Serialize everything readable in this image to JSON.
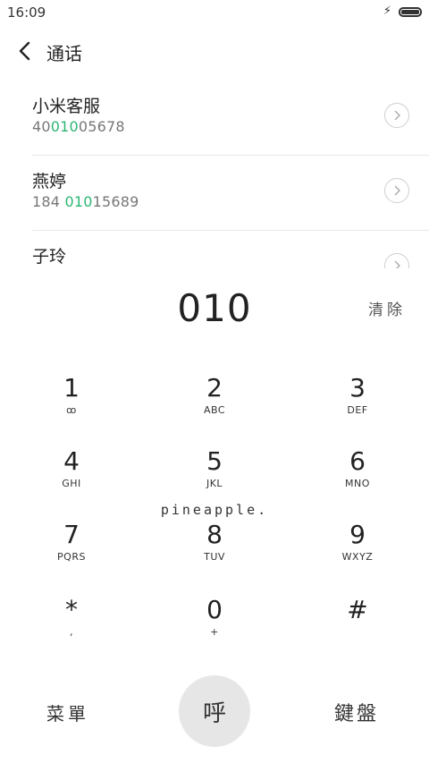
{
  "status_bar": {
    "time": "16:09",
    "charging_icon": "lightning-bolt-icon",
    "battery_icon": "battery-full-icon"
  },
  "header": {
    "back_icon": "chevron-left-icon",
    "title": "通话"
  },
  "contacts": [
    {
      "name": "小米客服",
      "number_pre": "40",
      "number_match": "010",
      "number_post": "05678"
    },
    {
      "name": "燕婷",
      "number_pre": "184 ",
      "number_match": "010",
      "number_post": "15689"
    },
    {
      "name": "子玲",
      "number_pre": "",
      "number_match": "",
      "number_post": ""
    }
  ],
  "highlight_color": "#2bb673",
  "display": {
    "digits": "010",
    "clear_label": "清除"
  },
  "keypad": [
    {
      "digit": "1",
      "letters": "ꝏ"
    },
    {
      "digit": "2",
      "letters": "ABC"
    },
    {
      "digit": "3",
      "letters": "DEF"
    },
    {
      "digit": "4",
      "letters": "GHI"
    },
    {
      "digit": "5",
      "letters": "JKL"
    },
    {
      "digit": "6",
      "letters": "MNO"
    },
    {
      "digit": "7",
      "letters": "PQRS"
    },
    {
      "digit": "8",
      "letters": "TUV"
    },
    {
      "digit": "9",
      "letters": "WXYZ"
    },
    {
      "digit": "*",
      "letters": ","
    },
    {
      "digit": "0",
      "letters": "+"
    },
    {
      "digit": "#",
      "letters": ""
    }
  ],
  "watermark": "pineapple.",
  "bottom_bar": {
    "menu_label": "菜單",
    "call_label": "呼",
    "keyboard_label": "鍵盤"
  }
}
